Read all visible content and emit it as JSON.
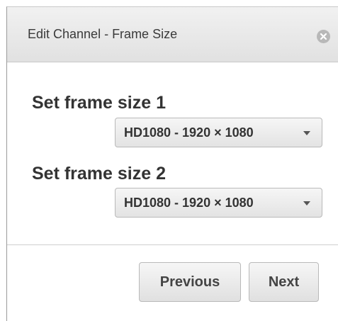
{
  "dialog": {
    "title": "Edit Channel - Frame Size",
    "close_icon": "close-icon"
  },
  "frame_sizes": [
    {
      "label": "Set frame size 1",
      "selected": "HD1080 - 1920 × 1080"
    },
    {
      "label": "Set frame size 2",
      "selected": "HD1080 - 1920 × 1080"
    }
  ],
  "buttons": {
    "previous": "Previous",
    "next": "Next"
  }
}
